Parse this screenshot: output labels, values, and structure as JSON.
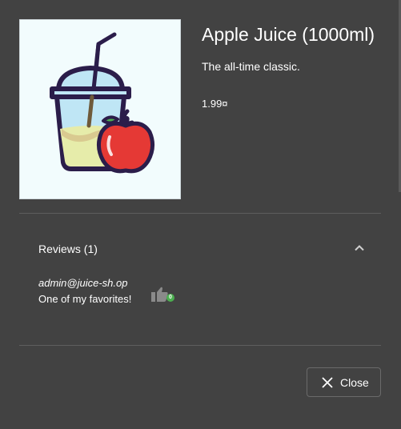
{
  "product": {
    "title": "Apple Juice (1000ml)",
    "description": "The all-time classic.",
    "price": "1.99¤",
    "image_icon": "apple-juice-cup-icon"
  },
  "reviews": {
    "header": "Reviews (1)",
    "expanded": true,
    "items": [
      {
        "author": "admin@juice-sh.op",
        "text": "One of my favorites!",
        "likes": "0"
      }
    ]
  },
  "actions": {
    "close_label": "Close"
  },
  "colors": {
    "background": "#424242",
    "image_bg": "#f2fcfd",
    "like_badge": "#4caf50"
  }
}
